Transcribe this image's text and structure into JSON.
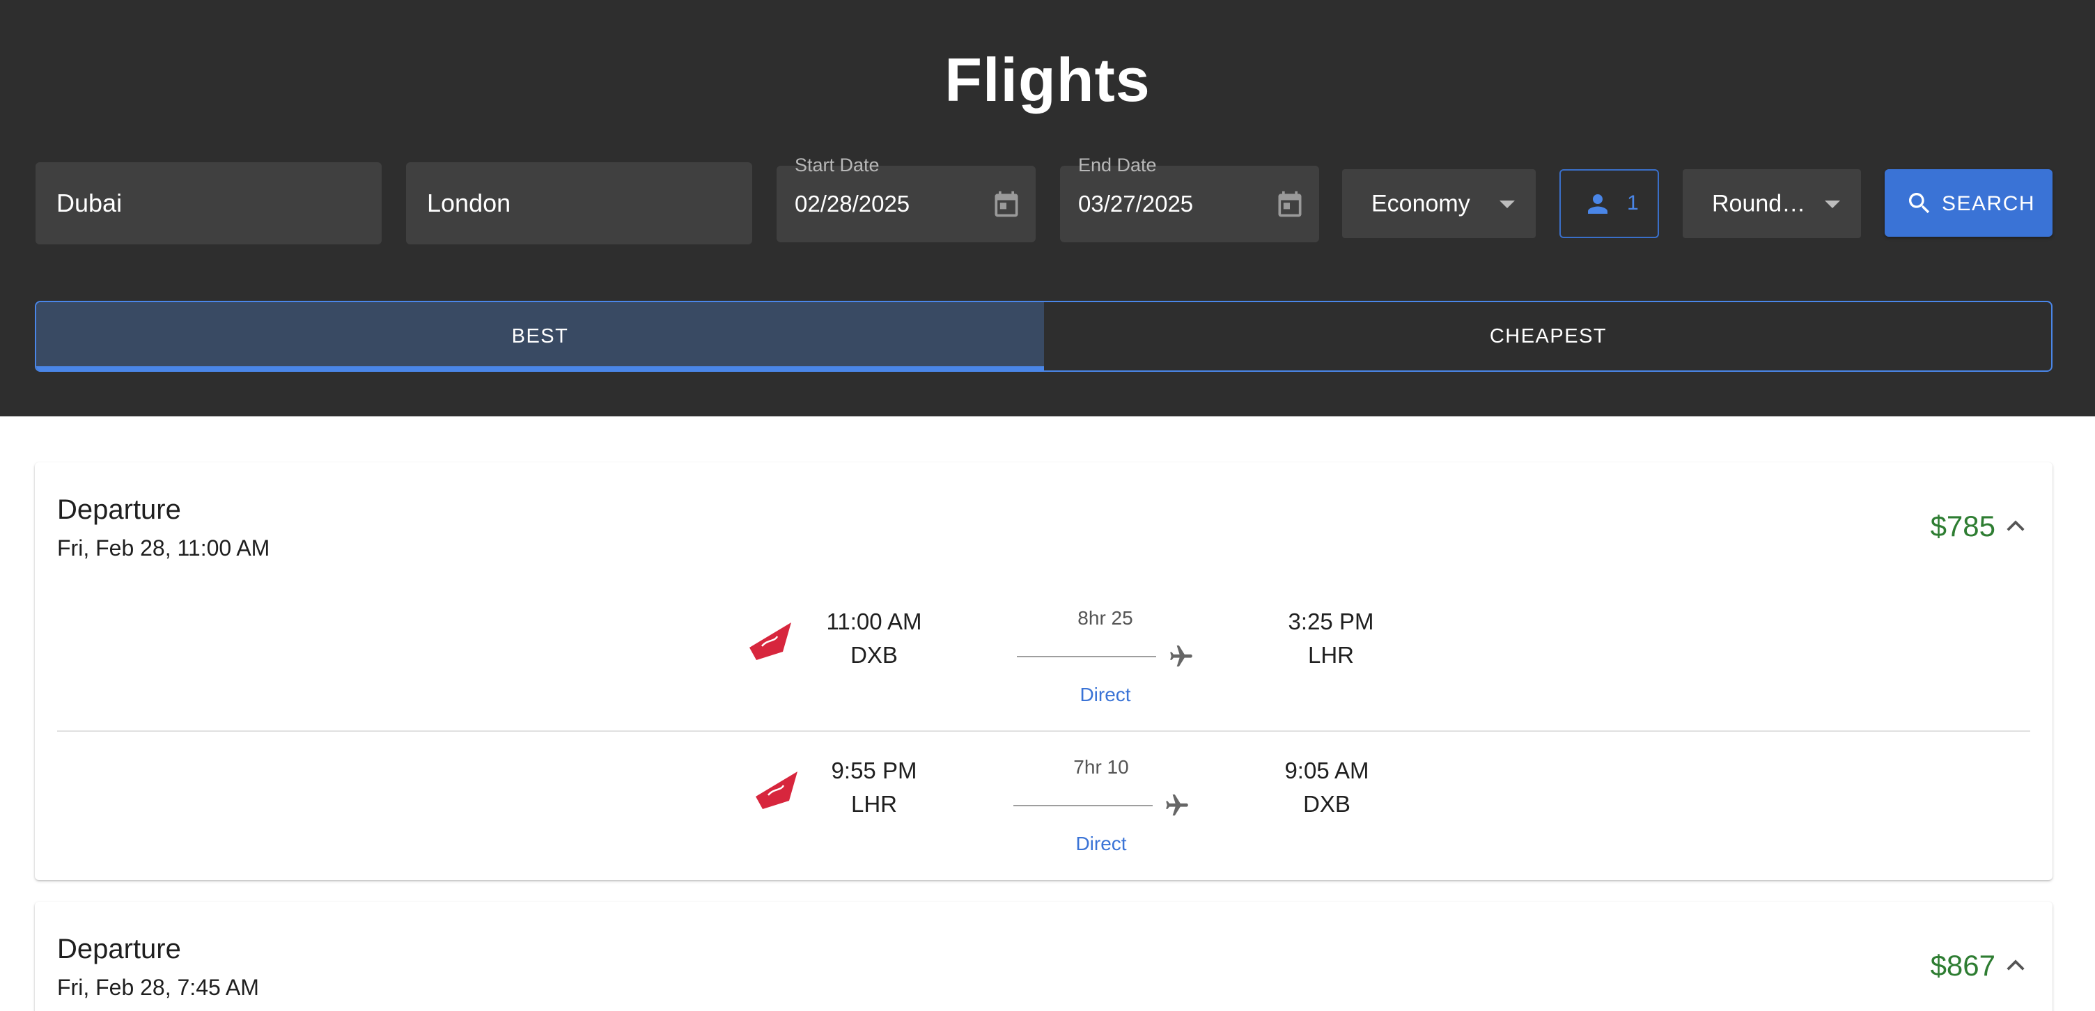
{
  "header": {
    "title": "Flights"
  },
  "search": {
    "origin": "Dubai",
    "destination": "London",
    "start_date_label": "Start Date",
    "start_date": "02/28/2025",
    "end_date_label": "End Date",
    "end_date": "03/27/2025",
    "cabin_class": "Economy",
    "passengers": "1",
    "trip_type": "Round…",
    "search_label": "SEARCH"
  },
  "tabs": [
    {
      "label": "BEST",
      "selected": true
    },
    {
      "label": "CHEAPEST",
      "selected": false
    }
  ],
  "results": [
    {
      "title": "Departure",
      "date": "Fri, Feb 28, 11:00 AM",
      "price": "$785",
      "legs": [
        {
          "depart_time": "11:00 AM",
          "depart_code": "DXB",
          "duration": "8hr 25",
          "stops": "Direct",
          "arrive_time": "3:25 PM",
          "arrive_code": "LHR"
        },
        {
          "depart_time": "9:55 PM",
          "depart_code": "LHR",
          "duration": "7hr 10",
          "stops": "Direct",
          "arrive_time": "9:05 AM",
          "arrive_code": "DXB"
        }
      ]
    },
    {
      "title": "Departure",
      "date": "Fri, Feb 28, 7:45 AM",
      "price": "$867"
    }
  ],
  "colors": {
    "header_bg": "#2e2e2e",
    "field_bg": "#404040",
    "accent": "#3a73d6",
    "price": "#2e7d32",
    "airline_logo": "#d7263d"
  },
  "icons": {
    "calendar": "calendar-icon",
    "person": "person-icon",
    "search": "search-icon",
    "plane": "airplane-icon",
    "chevron": "chevron-up-icon",
    "caret": "caret-down-icon"
  }
}
